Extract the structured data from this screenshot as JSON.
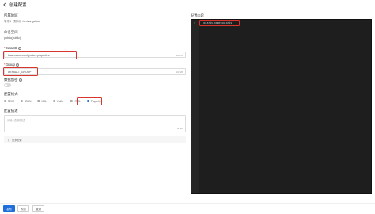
{
  "header": {
    "title": "创建配置"
  },
  "form": {
    "namespace": {
      "label": "所属地域",
      "value": "华东1（杭州）/cn-hangzhou"
    },
    "ns_space": {
      "label": "命名空间",
      "value": "public(public)"
    },
    "data_id": {
      "label": "Data ID",
      "required_mark": "*",
      "value": "local-nacos-config-client.properties",
      "count": "36/255"
    },
    "group": {
      "label": "Group",
      "required_mark": "*",
      "value": "DEFAULT_GROUP",
      "count": "13/128"
    },
    "encrypt": {
      "label": "数据加密",
      "state": "off"
    },
    "format": {
      "label": "配置格式",
      "options": [
        "TEXT",
        "JSON",
        "XML",
        "YAML",
        "HTML",
        "Properties"
      ],
      "selected": "Properties"
    },
    "desc": {
      "label": "配置描述",
      "placeholder": "请输入配置描述",
      "count": "0/128"
    },
    "more": {
      "label": "更多配置"
    }
  },
  "editor": {
    "label": "配置内容",
    "line_number": "1",
    "code": "polaris.name=polaris"
  },
  "footer": {
    "publish": "发布",
    "preview": "预览",
    "cancel": "取消"
  },
  "colors": {
    "primary": "#1e6fd9",
    "highlight": "#d9352f",
    "editor_bg": "#1e1e1e"
  }
}
